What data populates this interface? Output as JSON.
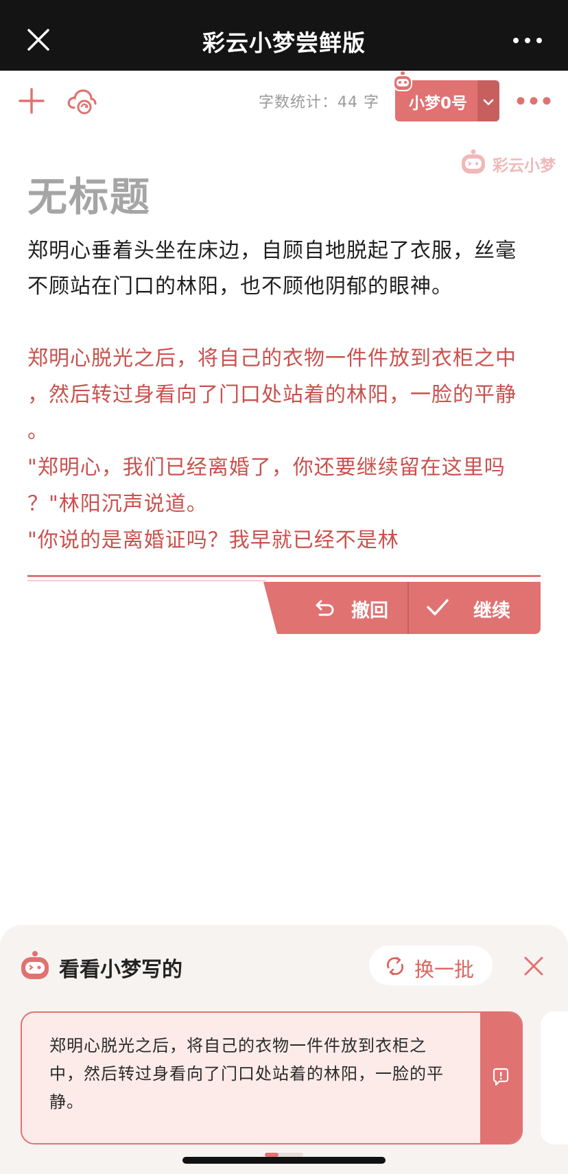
{
  "titlebar": {
    "title": "彩云小梦尝鲜版",
    "close_icon": "close-icon",
    "more_icon": "more-horizontal-icon"
  },
  "toolbar": {
    "add_icon": "plus-icon",
    "cloud_icon": "cloud-sync-icon",
    "word_count": "字数统计：44 字",
    "model_label": "小梦0号",
    "model_dropdown_icon": "chevron-down-icon",
    "menu_icon": "more-dots-icon"
  },
  "watermark": {
    "text": "彩云小梦"
  },
  "document": {
    "title": "无标题",
    "paragraph": [
      "郑明心垂着头坐在床边，自顾自地脱起了衣服，丝毫",
      "不顾站在门口的林阳，也不顾他阴郁的眼神。"
    ],
    "generated_lines": [
      "郑明心脱光之后，将自己的衣物一件件放到衣柜之中",
      "，然后转过身看向了门口处站着的林阳，一脸的平静",
      "。",
      "\"郑明心，我们已经离婚了，你还要继续留在这里吗",
      "？\"林阳沉声说道。",
      "\"你说的是离婚证吗？我早就已经不是林"
    ]
  },
  "actions": {
    "undo_label": "撤回",
    "continue_label": "继续"
  },
  "panel": {
    "title": "看看小梦写的",
    "refresh_label": "换一批",
    "suggestion_lines": [
      "郑明心脱光之后，将自己的衣物一件件放到衣柜之",
      "中，然后转过身看向了门口处站着的林阳，一脸的平",
      "静。"
    ]
  },
  "colors": {
    "accent": "#e07272",
    "generated_text": "#c9514d",
    "titlebar_bg": "#141414"
  }
}
